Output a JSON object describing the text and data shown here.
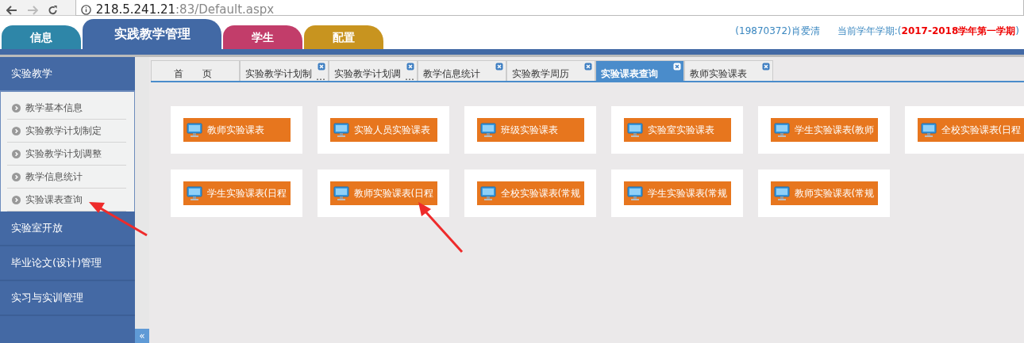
{
  "browser": {
    "url_host": "218.5.241.21",
    "url_path": ":83/Default.aspx"
  },
  "top_tabs": [
    {
      "label": "信息",
      "selected": false,
      "color": "#2e86a8"
    },
    {
      "label": "实践教学管理",
      "selected": true,
      "color": "#4269a5"
    },
    {
      "label": "学生",
      "selected": false,
      "color": "#c23d6a"
    },
    {
      "label": "配置",
      "selected": false,
      "color": "#c8941f"
    }
  ],
  "user": "(19870372)肖爱清",
  "term": "当前学年学期:(**2017-2018学年第一学期**)",
  "sidebar": [
    {
      "label": "实验教学",
      "expanded": true,
      "children": [
        {
          "label": "教学基本信息"
        },
        {
          "label": "实验教学计划制定"
        },
        {
          "label": "实验教学计划调整"
        },
        {
          "label": "教学信息统计"
        },
        {
          "label": "实验课表查询"
        }
      ]
    },
    {
      "label": "实验室开放",
      "expanded": false
    },
    {
      "label": "毕业论文(设计)管理",
      "expanded": false
    },
    {
      "label": "实习与实训管理",
      "expanded": false
    }
  ],
  "collapse_button": "«",
  "page_tabs": [
    {
      "label": "首　　页",
      "selected": false,
      "closable": false
    },
    {
      "label": "实验教学计划制",
      "ellipsis": "…",
      "selected": false,
      "closable": true
    },
    {
      "label": "实验教学计划调",
      "ellipsis": "…",
      "selected": false,
      "closable": true
    },
    {
      "label": "教学信息统计",
      "selected": false,
      "closable": true
    },
    {
      "label": "实验教学周历",
      "selected": false,
      "closable": true
    },
    {
      "label": "实验课表查询",
      "selected": true,
      "closable": true
    },
    {
      "label": "教师实验课表",
      "selected": false,
      "closable": true
    }
  ],
  "tiles": [
    {
      "label": "教师实验课表"
    },
    {
      "label": "实验人员实验课表"
    },
    {
      "label": "班级实验课表"
    },
    {
      "label": "实验室实验课表"
    },
    {
      "label": "学生实验课表(教师"
    },
    {
      "label": "全校实验课表(日程"
    },
    {
      "label": "学生实验课表(日程"
    },
    {
      "label": "教师实验课表(日程"
    },
    {
      "label": "全校实验课表(常规"
    },
    {
      "label": "学生实验课表(常规"
    },
    {
      "label": "教师实验课表(常规"
    }
  ]
}
